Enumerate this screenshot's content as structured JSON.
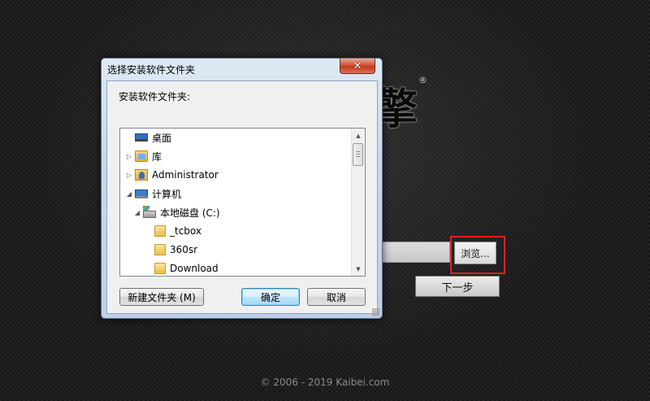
{
  "installer": {
    "brand_glyph": "擎",
    "reg_mark": "®",
    "browse_label": "浏览...",
    "next_label": "下一步",
    "copyright": "© 2006 - 2019 Kaibei.com"
  },
  "dialog": {
    "title": "选择安装软件文件夹",
    "close_symbol": "✕",
    "prompt": "安装软件文件夹:",
    "tree": [
      {
        "label": "桌面",
        "icon": "desktop-icon",
        "expander": "",
        "level": 0
      },
      {
        "label": "库",
        "icon": "library-icon",
        "expander": "▷",
        "level": 0
      },
      {
        "label": "Administrator",
        "icon": "user-folder-icon",
        "expander": "▷",
        "level": 0
      },
      {
        "label": "计算机",
        "icon": "computer-icon",
        "expander": "◢",
        "level": 0
      },
      {
        "label": "本地磁盘 (C:)",
        "icon": "drive-icon",
        "expander": "◢",
        "level": 1
      },
      {
        "label": "_tcbox",
        "icon": "folder-icon",
        "expander": "",
        "level": 2
      },
      {
        "label": "360sr",
        "icon": "folder-icon",
        "expander": "",
        "level": 2
      },
      {
        "label": "Download",
        "icon": "folder-icon",
        "expander": "",
        "level": 2
      }
    ],
    "scroll_up": "▲",
    "scroll_down": "▼",
    "new_folder_label": "新建文件夹 (M)",
    "ok_label": "确定",
    "cancel_label": "取消"
  },
  "colors": {
    "highlight": "#e02020",
    "dialog_frame": "#c9d9ec",
    "close_button": "#c23a20"
  }
}
